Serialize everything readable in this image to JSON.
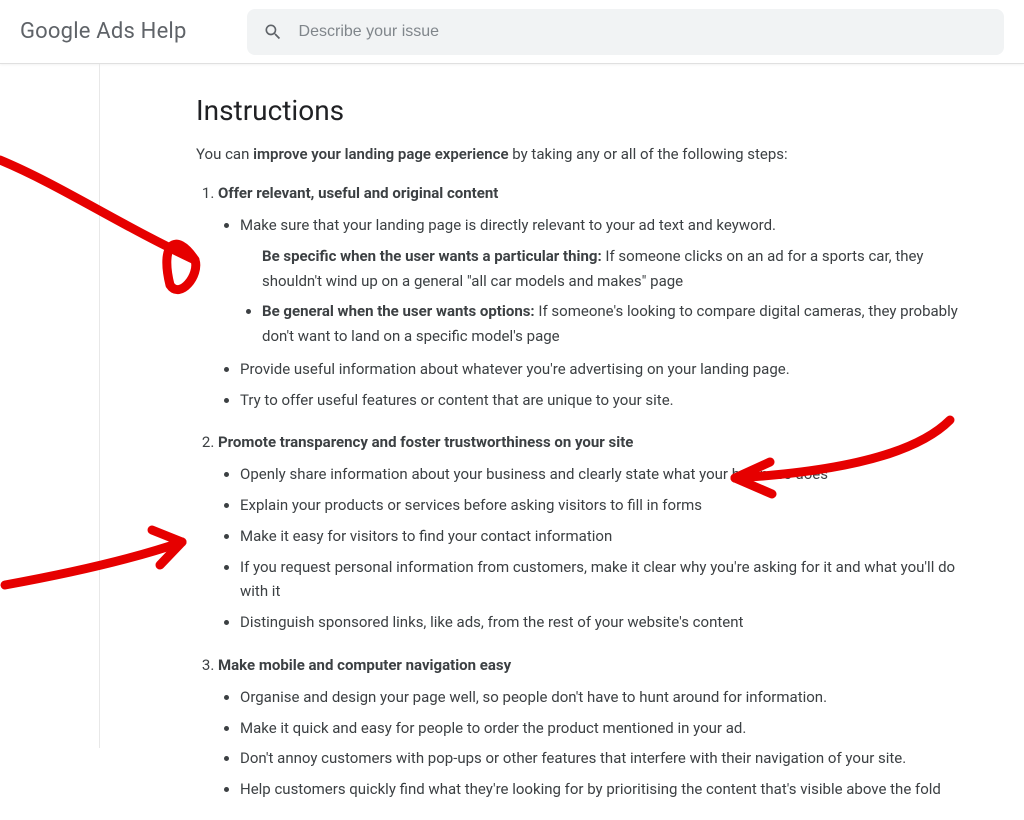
{
  "header": {
    "brand": "Google Ads Help",
    "search_placeholder": "Describe your issue"
  },
  "content": {
    "heading": "Instructions",
    "intro_pre": "You can ",
    "intro_bold": "improve your landing page experience",
    "intro_post": " by taking any or all of the following steps:",
    "items": [
      {
        "title": "Offer relevant, useful and original content",
        "subs": [
          {
            "plain": "Make sure that your landing page is directly relevant to your ad text and keyword."
          },
          {
            "nested": [
              {
                "bold": "Be specific when the user wants a particular thing:",
                "rest": " If someone clicks on an ad for a sports car, they shouldn't wind up on a general \"all car models and makes\" page"
              },
              {
                "bold": "Be general when the user wants options:",
                "rest": " If someone's looking to compare digital cameras, they probably don't want to land on a specific model's page"
              }
            ]
          },
          {
            "plain": "Provide useful information about whatever you're advertising on your landing page."
          },
          {
            "plain": "Try to offer useful features or content that are unique to your site."
          }
        ]
      },
      {
        "title": "Promote transparency and foster trustworthiness on your site",
        "subs": [
          {
            "plain": "Openly share information about your business and clearly state what your business does"
          },
          {
            "plain": "Explain your products or services before asking visitors to fill in forms"
          },
          {
            "plain": "Make it easy for visitors to find your contact information"
          },
          {
            "plain": "If you request personal information from customers, make it clear why you're asking for it and what you'll do with it"
          },
          {
            "plain": "Distinguish sponsored links, like ads, from the rest of your website's content"
          }
        ]
      },
      {
        "title": "Make mobile and computer navigation easy",
        "subs": [
          {
            "plain": "Organise and design your page well, so people don't have to hunt around for information."
          },
          {
            "plain": "Make it quick and easy for people to order the product mentioned in your ad."
          },
          {
            "plain": "Don't annoy customers with pop-ups or other features that interfere with their navigation of your site."
          },
          {
            "plain": "Help customers quickly find what they're looking for by prioritising the content that's visible above the fold"
          }
        ]
      }
    ]
  },
  "colors": {
    "annotation": "#e60000"
  }
}
